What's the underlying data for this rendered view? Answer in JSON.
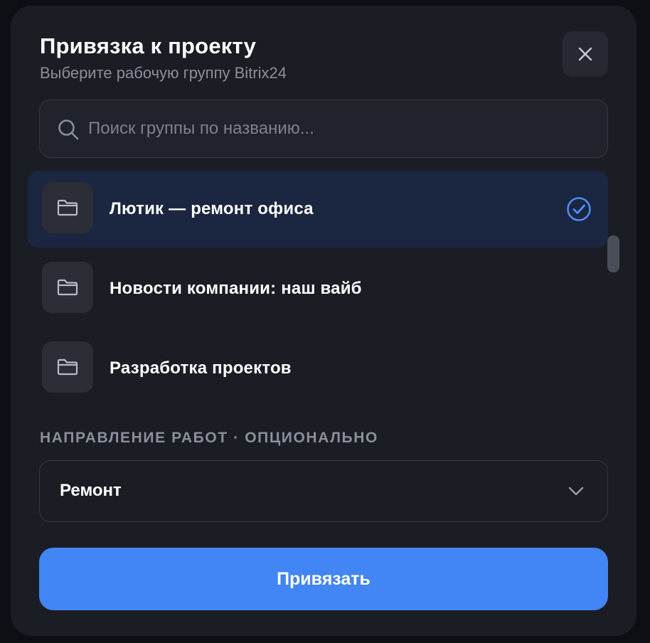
{
  "dialog": {
    "title": "Привязка к проекту",
    "subtitle": "Выберите рабочую группу Bitrix24",
    "close_icon": "close-icon"
  },
  "search": {
    "placeholder": "Поиск группы по названию...",
    "value": "",
    "icon": "search-icon"
  },
  "groups": [
    {
      "label": "Лютик — ремонт офиса",
      "icon": "folder-icon",
      "selected": true
    },
    {
      "label": "Новости компании: наш вайб",
      "icon": "folder-icon",
      "selected": false
    },
    {
      "label": "Разработка проектов",
      "icon": "folder-icon",
      "selected": false
    }
  ],
  "direction": {
    "section_label": "НАПРАВЛЕНИЕ РАБОТ · ОПЦИОНАЛЬНО",
    "selected_value": "Ремонт",
    "icon": "chevron-down-icon"
  },
  "submit": {
    "label": "Привязать"
  },
  "colors": {
    "accent": "#4285f4",
    "selected_row": "#1b2640",
    "modal_bg": "#1b1d24",
    "check": "#4b8df8"
  }
}
